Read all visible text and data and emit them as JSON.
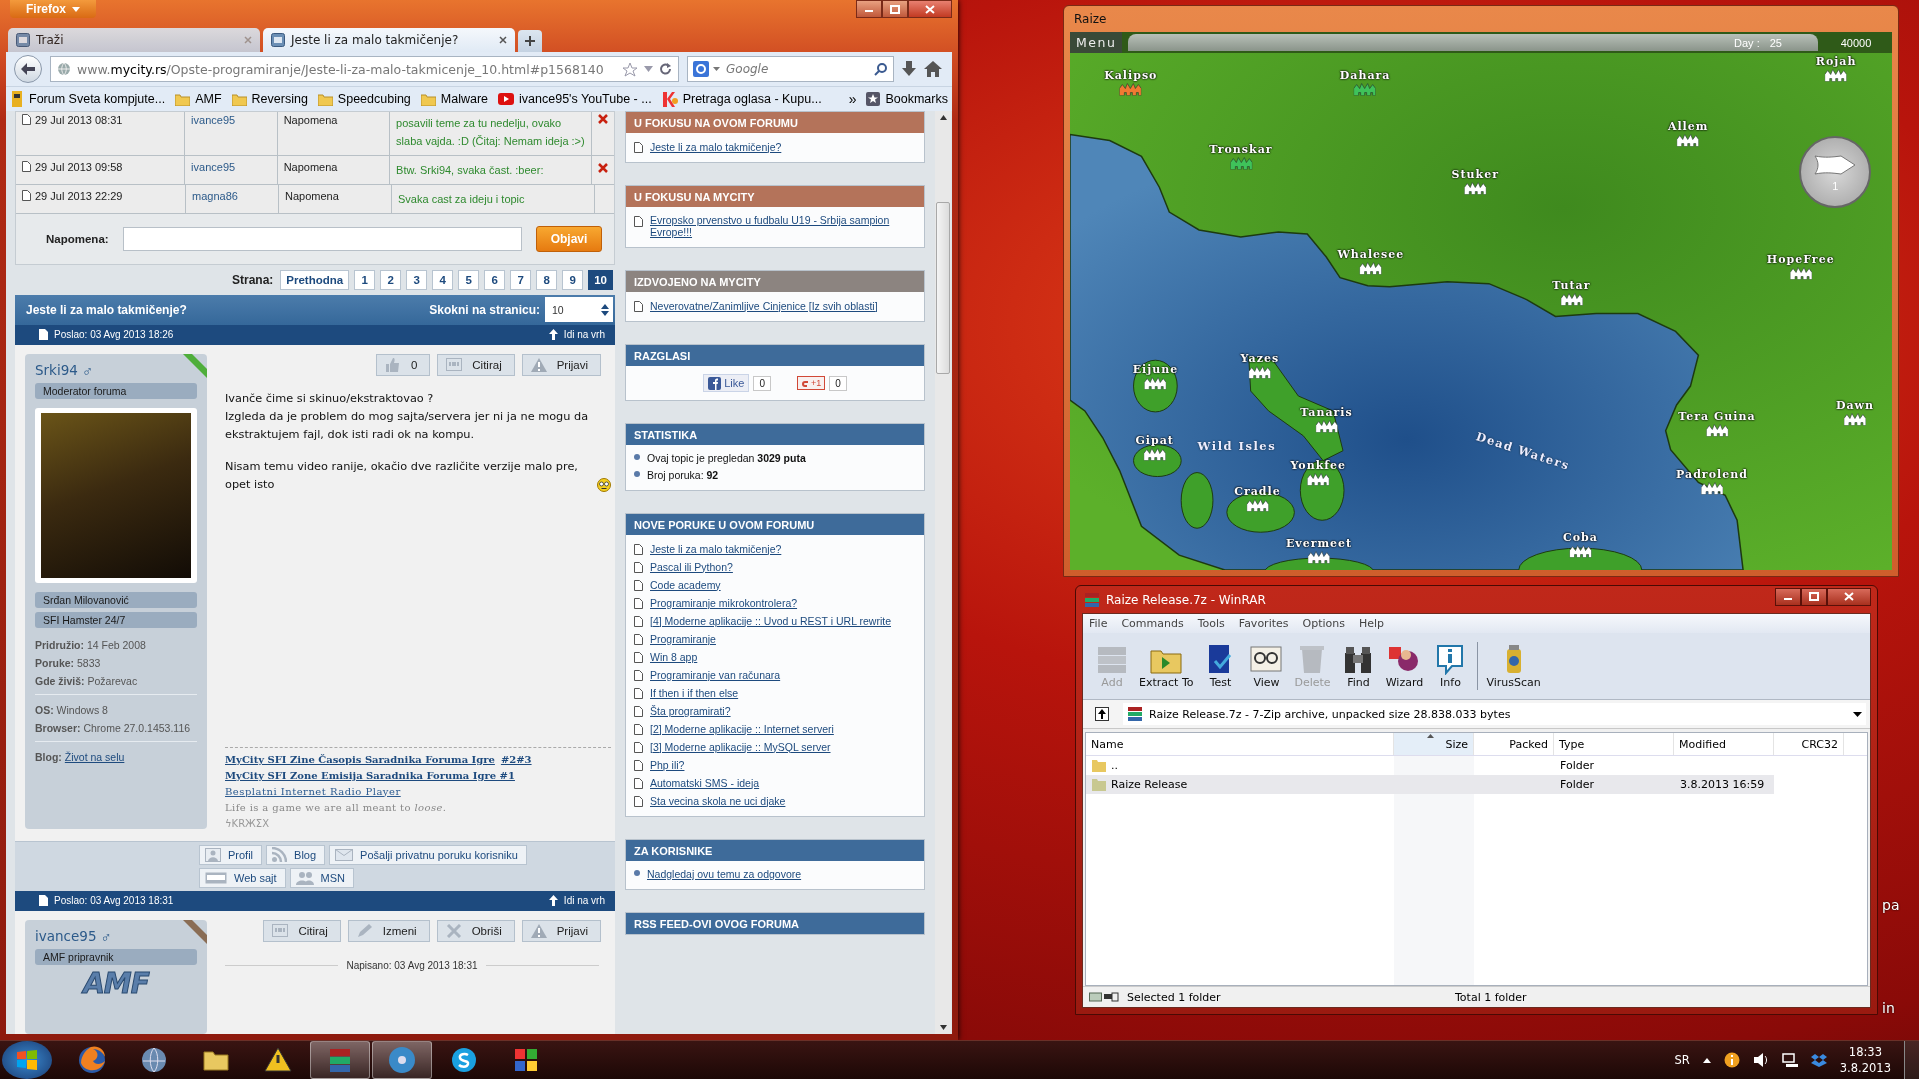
{
  "desktop": {
    "icon_labels": [
      "pa",
      "in"
    ]
  },
  "firefox": {
    "menu_button": "Firefox",
    "tabs": [
      {
        "title": "Traži",
        "selected": false
      },
      {
        "title": "Jeste li za malo takmičenje?",
        "selected": true
      }
    ],
    "url": "www.**mycity.rs**/Opste-programiranje/Jeste-li-za-malo-takmicenje_10.html#p1568140",
    "search_placeholder": "Google",
    "bookmarks": [
      {
        "label": "Forum Sveta kompjute...",
        "kind": "site"
      },
      {
        "label": "AMF",
        "kind": "folder"
      },
      {
        "label": "Reversing",
        "kind": "folder"
      },
      {
        "label": "Speedcubing",
        "kind": "folder"
      },
      {
        "label": "Malware",
        "kind": "folder"
      },
      {
        "label": "ivance95's YouTube - ...",
        "kind": "video"
      },
      {
        "label": "Pretraga oglasa - Kupu...",
        "kind": "classifieds"
      }
    ],
    "bookmarks_overflow": "»",
    "bookmarks_menu": "Bookmarks"
  },
  "forum": {
    "notes": [
      {
        "date": "29 Jul 2013 08:31",
        "user": "ivance95",
        "type": "Napomena",
        "text": "posavili teme za tu nedelju, ovako slaba vajda. :D (Čitaj: Nemam ideja :>)",
        "deletable": true
      },
      {
        "date": "29 Jul 2013 09:58",
        "user": "ivance95",
        "type": "Napomena",
        "text": "Btw. Srki94, svaka čast. :beer:",
        "deletable": true
      },
      {
        "date": "29 Jul 2013 22:29",
        "user": "magna86",
        "type": "Napomena",
        "text": "Svaka cast za ideju i topic",
        "deletable": false
      }
    ],
    "note_form": {
      "label": "Napomena:",
      "button": "Objavi"
    },
    "pagination": {
      "label": "Strana:",
      "previous": "Prethodna",
      "pages": [
        {
          "label": "1",
          "selected": false
        },
        {
          "label": "2",
          "selected": false
        },
        {
          "label": "3",
          "selected": false
        },
        {
          "label": "4",
          "selected": false
        },
        {
          "label": "5",
          "selected": false
        },
        {
          "label": "6",
          "selected": false
        },
        {
          "label": "7",
          "selected": false
        },
        {
          "label": "8",
          "selected": false
        },
        {
          "label": "9",
          "selected": false
        },
        {
          "label": "10",
          "selected": true
        }
      ]
    },
    "topic": {
      "title": "Jeste li za malo takmičenje?",
      "jump_label": "Skokni na stranicu:",
      "jump_value": "10"
    },
    "posts": [
      {
        "posted": "Poslao: 03 Avg 2013 18:26",
        "top_link": "Idi na vrh",
        "author": "Srki94",
        "gender": "♂",
        "color": "#4fae3b",
        "rank": "Moderator foruma",
        "avatar": true,
        "tags": [
          "Srđan Milovanović",
          "SFI Hamster 24/7"
        ],
        "details": [
          "**Pridružio:** 14 Feb 2008",
          "**Poruke:** 5833",
          "**Gde živiš:** Požarevac"
        ],
        "system": [
          "**OS:** Windows 8",
          "**Browser:** Chrome 27.0.1453.116"
        ],
        "blog": {
          "label": "Blog:",
          "link": "Život na selu"
        },
        "actions": [
          {
            "label": "0",
            "kind": "like"
          },
          {
            "label": "Citiraj",
            "kind": "quote"
          },
          {
            "label": "Prijavi",
            "kind": "report"
          }
        ],
        "paragraphs": [
          "Ivanče čime si skinuo/ekstraktovao ?\nIzgleda da je problem do mog sajta/servera jer ni ja ne mogu da ekstraktujem fajl, dok isti radi ok na kompu.",
          "Nisam temu video ranije, okačio dve različite verzije malo pre, opet isto"
        ],
        "signature": {
          "links": [
            [
              "MyCity SFI Zine Časopis Saradnika Foruma Igre",
              "#2#3"
            ],
            [
              "MyCity SFI Zone Emisija Saradnika Foruma Igre #1"
            ]
          ],
          "radio_link": "Besplatni Internet Radio Player",
          "quote": "Life is a game we are all meant to *loose*.",
          "mark": "ϟKRЖΣX"
        },
        "profile_buttons": [
          {
            "label": "Profil",
            "kind": "profile"
          },
          {
            "label": "Blog",
            "kind": "rss"
          },
          {
            "label": "Pošalji privatnu poruku korisniku",
            "kind": "mail"
          },
          {
            "label": "Web sajt",
            "kind": "www"
          },
          {
            "label": "MSN",
            "kind": "people"
          }
        ]
      },
      {
        "posted": "Poslao: 03 Avg 2013 18:31",
        "top_link": "Idi na vrh",
        "author": "ivance95",
        "gender": "♂",
        "color": "#8a6d55",
        "rank": "AMF pripravnik",
        "logo": "AMF",
        "actions": [
          {
            "label": "Citiraj",
            "kind": "quote"
          },
          {
            "label": "Izmeni",
            "kind": "edit"
          },
          {
            "label": "Obriši",
            "kind": "delete"
          },
          {
            "label": "Prijavi",
            "kind": "report"
          }
        ],
        "written": "Napisano: 03 Avg 2013 18:31"
      }
    ]
  },
  "sidebar": [
    {
      "title": "U FOKUSU NA OVOM FORUMU",
      "color": "#b4735a",
      "kind": "links",
      "items": [
        "Jeste li za malo takmičenje?"
      ]
    },
    {
      "title": "U FOKUSU NA MYCITY",
      "color": "#b4735a",
      "kind": "links",
      "items": [
        "Evropsko prvenstvo u fudbalu U19 - Srbija sampion Evrope!!!"
      ]
    },
    {
      "title": "IZDVOJENO NA MYCITY",
      "color": "#8c8480",
      "kind": "links",
      "items": [
        "Neverovatne/Zanimljive Cinjenice [Iz svih oblasti]"
      ]
    },
    {
      "title": "RAZGLASI",
      "color": "#3e6b9a",
      "kind": "social",
      "like": "Like",
      "like_count": "0",
      "plus": "+1",
      "plus_count": "0"
    },
    {
      "title": "STATISTIKA",
      "color": "#3e6b9a",
      "kind": "bullets",
      "items": [
        "Ovaj topic je pregledan **3029 puta**",
        "Broj poruka: **92**"
      ]
    },
    {
      "title": "NOVE PORUKE U OVOM FORUMU",
      "color": "#3e6b9a",
      "kind": "links",
      "items": [
        "Jeste li za malo takmičenje?",
        "Pascal ili Python?",
        "Code academy",
        "Programiranje mikrokontrolera?",
        "[4] Moderne aplikacije :: Uvod u REST i URL rewrite",
        "Programiranje",
        "Win 8 app",
        "Programiranje van računara",
        "If then i if then else",
        "Šta programirati?",
        "[2] Moderne aplikacije :: Internet serveri",
        "[3] Moderne aplikacije :: MySQL server",
        "Php ili?",
        "Automatski SMS - ideja",
        "Sta vecina skola ne uci djake"
      ]
    },
    {
      "title": "ZA KORISNIKE",
      "color": "#3e6b9a",
      "kind": "bullet_links",
      "items": [
        "Nadgledaj ovu temu za odgovore"
      ]
    },
    {
      "title": "RSS FEED-OVI OVOG FORUMA",
      "color": "#3e6b9a",
      "kind": "links"
    }
  ],
  "game": {
    "title": "Raize",
    "menu": "Menu",
    "day_label": "Day :",
    "day": "25",
    "money": "40000",
    "cities": [
      {
        "name": "Kalipso",
        "color": "#f07a32"
      },
      {
        "name": "Dahara",
        "color": "#3fc25a"
      },
      {
        "name": "Rojah",
        "color": "#ffffff"
      },
      {
        "name": "Allem",
        "color": "#ffffff"
      },
      {
        "name": "Tronskar",
        "color": "#3fc25a"
      },
      {
        "name": "Stuker",
        "color": "#ffffff"
      },
      {
        "name": "Whalesee",
        "color": "#ffffff"
      },
      {
        "name": "Tutar",
        "color": "#ffffff"
      },
      {
        "name": "HopeFree",
        "color": "#ffffff"
      },
      {
        "name": "Eijune",
        "color": "#ffffff"
      },
      {
        "name": "Yazes",
        "color": "#ffffff"
      },
      {
        "name": "Tanaris",
        "color": "#ffffff"
      },
      {
        "name": "Gipat",
        "color": "#ffffff"
      },
      {
        "name": "Yonkfee",
        "color": "#ffffff"
      },
      {
        "name": "Cradle",
        "color": "#ffffff"
      },
      {
        "name": "Evermeet",
        "color": "#ffffff"
      },
      {
        "name": "Coba",
        "color": "#ffffff"
      },
      {
        "name": "Tera Guina",
        "color": "#ffffff"
      },
      {
        "name": "Padrolend",
        "color": "#ffffff"
      },
      {
        "name": "Dawn",
        "color": "#ffffff"
      }
    ],
    "regions": [
      "Wild Isles",
      "Dead Waters"
    ],
    "next_turn": "1"
  },
  "winrar": {
    "title": "Raize Release.7z - WinRAR",
    "menu": [
      "File",
      "Commands",
      "Tools",
      "Favorites",
      "Options",
      "Help"
    ],
    "toolbar": [
      {
        "label": "Add",
        "disabled": true
      },
      {
        "label": "Extract To",
        "disabled": false
      },
      {
        "label": "Test",
        "disabled": false
      },
      {
        "label": "View",
        "disabled": false
      },
      {
        "label": "Delete",
        "disabled": true
      },
      {
        "label": "Find",
        "disabled": false
      },
      {
        "label": "Wizard",
        "disabled": false
      },
      {
        "label": "Info",
        "disabled": false
      },
      {
        "label": "VirusScan",
        "disabled": false
      }
    ],
    "path": "Raize Release.7z - 7-Zip archive, unpacked size 28.838.033 bytes",
    "columns": [
      {
        "label": "Name",
        "sorted": false
      },
      {
        "label": "Size",
        "sorted": true
      },
      {
        "label": "Packed",
        "sorted": false
      },
      {
        "label": "Type",
        "sorted": false
      },
      {
        "label": "Modified",
        "sorted": false
      },
      {
        "label": "CRC32",
        "sorted": false
      }
    ],
    "rows": [
      {
        "name": "..",
        "type": "Folder",
        "selected": false
      },
      {
        "name": "Raize Release",
        "type": "Folder",
        "modified": "3.8.2013 16:59",
        "selected": true
      }
    ],
    "status_left": "Selected 1 folder",
    "status_right": "Total 1 folder"
  },
  "taskbar": {
    "apps": [
      {
        "kind": "browser",
        "active": false
      },
      {
        "kind": "mail",
        "active": false
      },
      {
        "kind": "folder",
        "active": false
      },
      {
        "kind": "warning",
        "active": false
      },
      {
        "kind": "archiver",
        "active": true
      },
      {
        "kind": "disc",
        "active": true
      },
      {
        "kind": "chat",
        "active": false
      },
      {
        "kind": "tiles",
        "active": false
      }
    ],
    "language": "SR",
    "time": "18:33",
    "date": "3.8.2013"
  }
}
